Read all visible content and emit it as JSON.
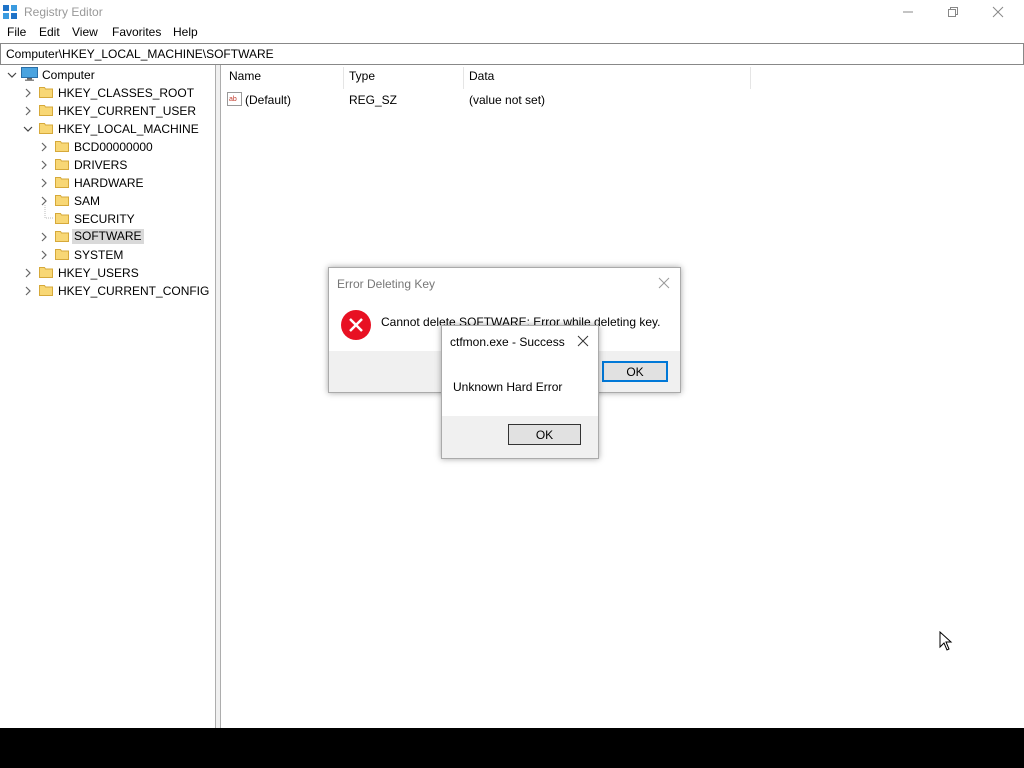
{
  "window": {
    "title": "Registry Editor"
  },
  "menu": [
    "File",
    "Edit",
    "View",
    "Favorites",
    "Help"
  ],
  "address": "Computer\\HKEY_LOCAL_MACHINE\\SOFTWARE",
  "tree": {
    "root": "Computer",
    "hives": [
      "HKEY_CLASSES_ROOT",
      "HKEY_CURRENT_USER",
      "HKEY_LOCAL_MACHINE"
    ],
    "hklm_children": [
      "BCD00000000",
      "DRIVERS",
      "HARDWARE",
      "SAM",
      "SECURITY",
      "SOFTWARE",
      "SYSTEM"
    ],
    "hives_after": [
      "HKEY_USERS",
      "HKEY_CURRENT_CONFIG"
    ]
  },
  "list": {
    "columns": [
      "Name",
      "Type",
      "Data"
    ],
    "rows": [
      {
        "name": "(Default)",
        "type": "REG_SZ",
        "data": "(value not set)"
      }
    ]
  },
  "error_dialog": {
    "title": "Error Deleting Key",
    "message": "Cannot delete SOFTWARE:  Error while deleting key.",
    "ok": "OK"
  },
  "success_dialog": {
    "title": "ctfmon.exe - Success",
    "message": "Unknown Hard Error",
    "ok": "OK"
  },
  "colors": {
    "accent": "#0078d7",
    "error": "#e81123",
    "folder": "#f8d775",
    "selection": "#d9d9d9"
  }
}
